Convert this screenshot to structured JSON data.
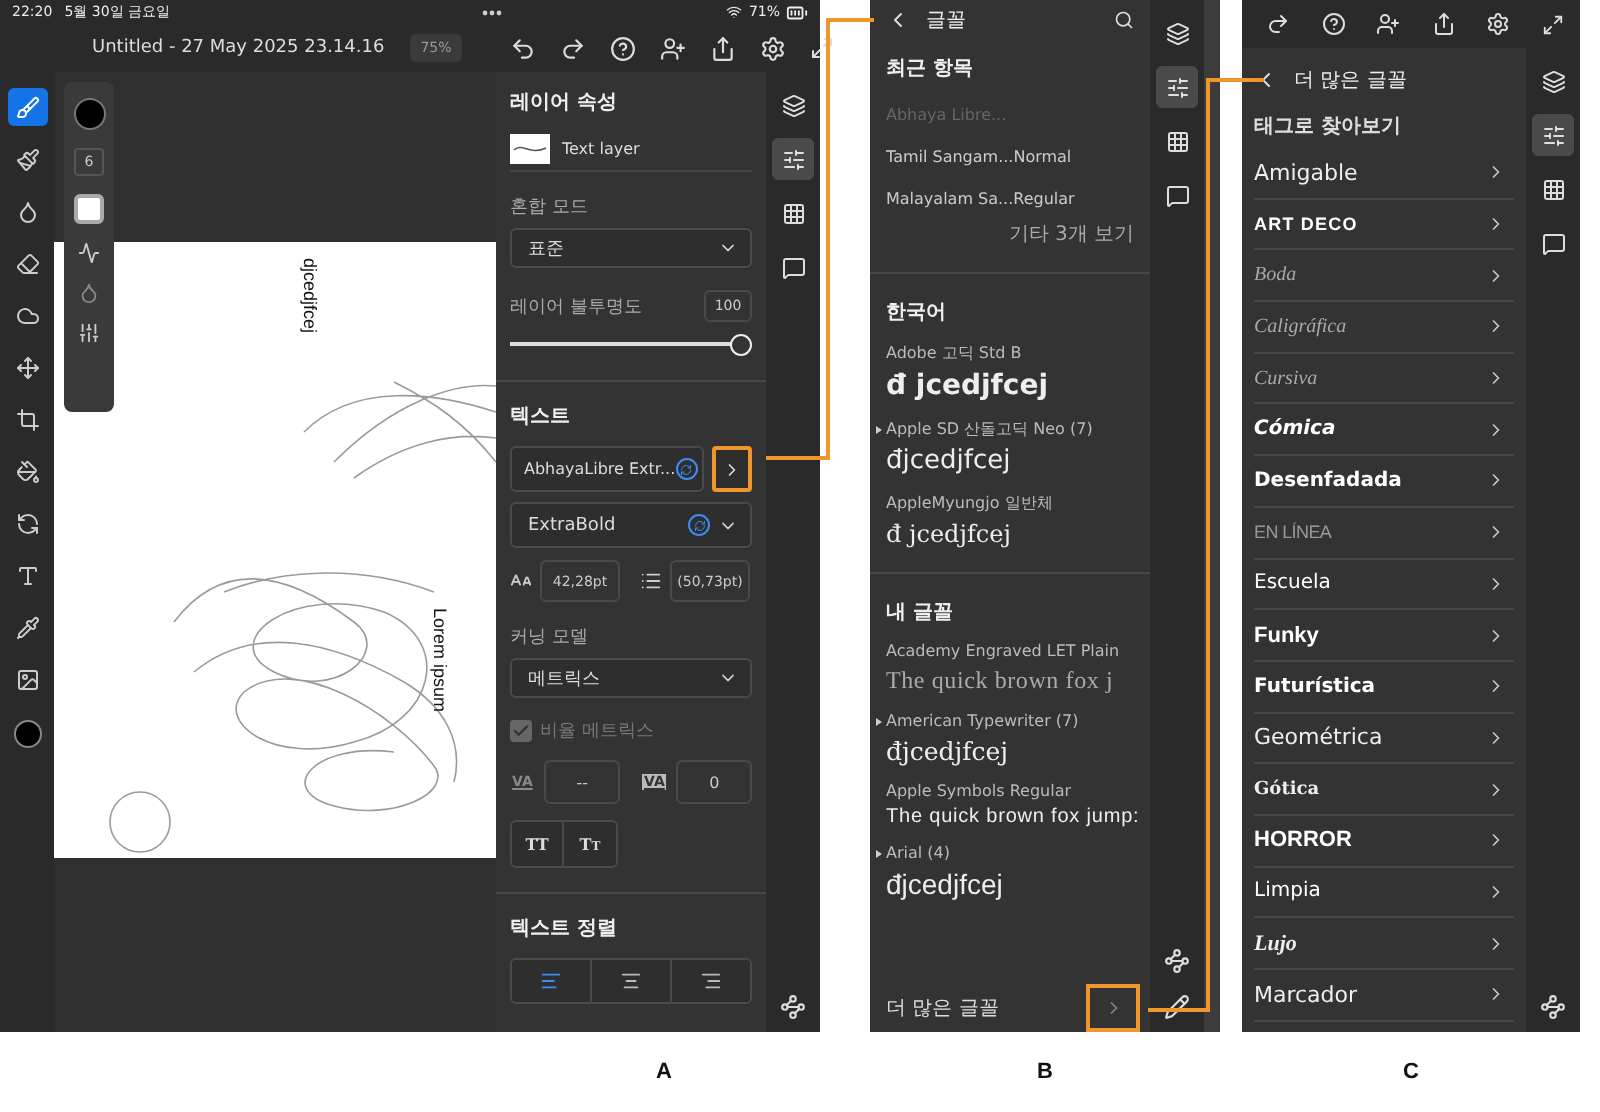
{
  "screen_a": {
    "status_bar": {
      "time": "22:20",
      "date": "5월 30일 금요일",
      "battery": "71%"
    },
    "toolbar": {
      "title": "Untitled - 27 May 2025 23.14.16",
      "zoom": "75%"
    },
    "tools": [
      {
        "kind": "brush",
        "selected": true
      },
      {
        "kind": "paintbrush",
        "selected": false
      },
      {
        "kind": "ink",
        "selected": false
      },
      {
        "kind": "eraser",
        "selected": false
      },
      {
        "kind": "smudge",
        "selected": false
      },
      {
        "kind": "move",
        "selected": false
      },
      {
        "kind": "transform",
        "selected": false
      },
      {
        "kind": "fill",
        "selected": false
      },
      {
        "kind": "rotate",
        "selected": false
      },
      {
        "kind": "text",
        "selected": false
      },
      {
        "kind": "eyedropper",
        "selected": false
      },
      {
        "kind": "image",
        "selected": false
      }
    ],
    "brush_options": {
      "size": "6"
    },
    "canvas_texts": [
      "djcedjfcej",
      "Lorem ipsum"
    ],
    "properties": {
      "heading": "레이어 속성",
      "layer_name": "Text layer",
      "blend": {
        "label": "혼합 모드",
        "value": "표준"
      },
      "opacity": {
        "label": "레이어 불투명도",
        "value": "100",
        "level": 1
      }
    },
    "text": {
      "heading": "텍스트",
      "font": "AbhayaLibre Extr...",
      "font_button_highlighted": true,
      "style": "ExtraBold",
      "size": "42,28pt",
      "leading": "(50,73pt)",
      "kerning": {
        "label": "커닝 모델",
        "value": "메트릭스"
      },
      "proportional": {
        "label": "비율 메트릭스",
        "checked": true,
        "disabled": true
      },
      "tracking": [
        {
          "label": "VA",
          "value": "--",
          "kind": "plain"
        },
        {
          "label": "VA",
          "value": "0",
          "kind": "boxed"
        }
      ],
      "case_buttons": [
        "TT",
        "Tt"
      ]
    },
    "alignment": {
      "heading": "텍스트 정렬",
      "options": [
        {
          "kind": "left",
          "selected": true
        },
        {
          "kind": "center",
          "selected": false
        },
        {
          "kind": "right",
          "selected": false
        }
      ]
    },
    "rail": [
      {
        "kind": "layers",
        "selected": false
      },
      {
        "kind": "properties",
        "selected": true
      },
      {
        "kind": "grid",
        "selected": false
      },
      {
        "kind": "comments",
        "selected": false
      }
    ]
  },
  "screen_b": {
    "title": "글꼴",
    "recent": {
      "heading": "최근 항목",
      "items": [
        {
          "name": "Abhaya Libre...",
          "disabled": true
        },
        {
          "name": "Tamil Sangam...",
          "style": "Normal",
          "disabled": false
        },
        {
          "name": "Malayalam Sa...",
          "style": "Regular",
          "disabled": false
        }
      ],
      "more": "기타 3개 보기"
    },
    "sections": [
      {
        "heading": "한국어",
        "fonts": [
          {
            "name": "Adobe 고딕 Std B",
            "sample": "đ jcedjfcej",
            "kind": "sans-bold",
            "expandable": false
          },
          {
            "name": "Apple SD 산돌고딕 Neo (7)",
            "sample": "đjcedjfcej",
            "kind": "sans",
            "expandable": true
          },
          {
            "name": "AppleMyungjo 일반체",
            "sample": "đ jcedjfcej",
            "kind": "serif",
            "expandable": false
          }
        ]
      },
      {
        "heading": "내 글꼴",
        "fonts": [
          {
            "name": "Academy Engraved LET Plain",
            "sample": "The quick brown fox j",
            "kind": "engraved",
            "expandable": false
          },
          {
            "name": "American Typewriter (7)",
            "sample": "đjcedjfcej",
            "kind": "typewriter",
            "expandable": true
          },
          {
            "name": "Apple Symbols Regular",
            "sample": "The quick brown fox jump:",
            "kind": "symbols",
            "expandable": false
          },
          {
            "name": "Arial (4)",
            "sample": "đjcedjfcej",
            "kind": "arial",
            "expandable": true
          }
        ]
      }
    ],
    "more_fonts": {
      "label": "더 많은 글꼴",
      "highlighted": true
    },
    "rail": [
      {
        "kind": "layers",
        "selected": false
      },
      {
        "kind": "properties",
        "selected": true
      },
      {
        "kind": "grid",
        "selected": false
      },
      {
        "kind": "comments",
        "selected": false
      }
    ]
  },
  "screen_c": {
    "title": "더 많은 글꼴",
    "subtitle": "태그로 찾아보기",
    "tags": [
      {
        "name": "Amigable",
        "kind": "rounded"
      },
      {
        "name": "ART DECO",
        "kind": "deco"
      },
      {
        "name": "Boda",
        "kind": "script"
      },
      {
        "name": "Caligráfica",
        "kind": "script"
      },
      {
        "name": "Cursiva",
        "kind": "script"
      },
      {
        "name": "Cómica",
        "kind": "comic"
      },
      {
        "name": "Desenfadada",
        "kind": "bold"
      },
      {
        "name": "EN LÍNEA",
        "kind": "condensed"
      },
      {
        "name": "Escuela",
        "kind": "plain"
      },
      {
        "name": "Funky",
        "kind": "heavy"
      },
      {
        "name": "Futurística",
        "kind": "bold"
      },
      {
        "name": "Geométrica",
        "kind": "rounded"
      },
      {
        "name": "Gótica",
        "kind": "blackletter"
      },
      {
        "name": "HORROR",
        "kind": "heavy"
      },
      {
        "name": "Limpia",
        "kind": "plain"
      },
      {
        "name": "Lujo",
        "kind": "luxe"
      },
      {
        "name": "Marcador",
        "kind": "rounded"
      }
    ],
    "rail": [
      {
        "kind": "layers",
        "selected": false
      },
      {
        "kind": "properties",
        "selected": true
      },
      {
        "kind": "grid",
        "selected": false
      },
      {
        "kind": "comments",
        "selected": false
      }
    ]
  },
  "captions": [
    "A",
    "B",
    "C"
  ]
}
